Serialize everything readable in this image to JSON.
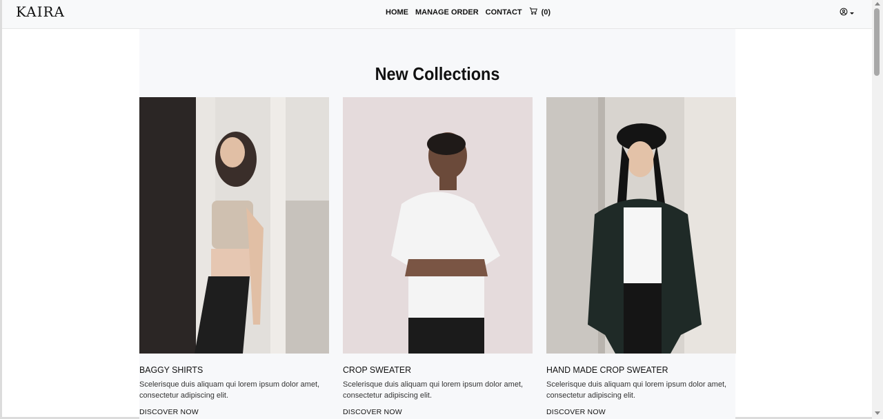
{
  "brand": "KAIRA",
  "nav": {
    "home": "HOME",
    "manage_order": "MANAGE ORDER",
    "contact": "CONTACT",
    "cart_count": "(0)"
  },
  "icons": {
    "cart": "cart-icon",
    "user": "user-circle-icon",
    "caret": "caret-down-icon"
  },
  "section": {
    "title": "New Collections",
    "products": [
      {
        "name": "BAGGY SHIRTS",
        "desc": "Scelerisque duis aliquam qui lorem ipsum dolor amet, consectetur adipiscing elit.",
        "cta": "DISCOVER NOW"
      },
      {
        "name": "CROP SWEATER",
        "desc": "Scelerisque duis aliquam qui lorem ipsum dolor amet, consectetur adipiscing elit.",
        "cta": "DISCOVER NOW"
      },
      {
        "name": "HAND MADE CROP SWEATER",
        "desc": "Scelerisque duis aliquam qui lorem ipsum dolor amet, consectetur adipiscing elit.",
        "cta": "DISCOVER NOW"
      }
    ]
  },
  "colors": {
    "panel_bg": "#f7f8fa",
    "text": "#111111"
  }
}
